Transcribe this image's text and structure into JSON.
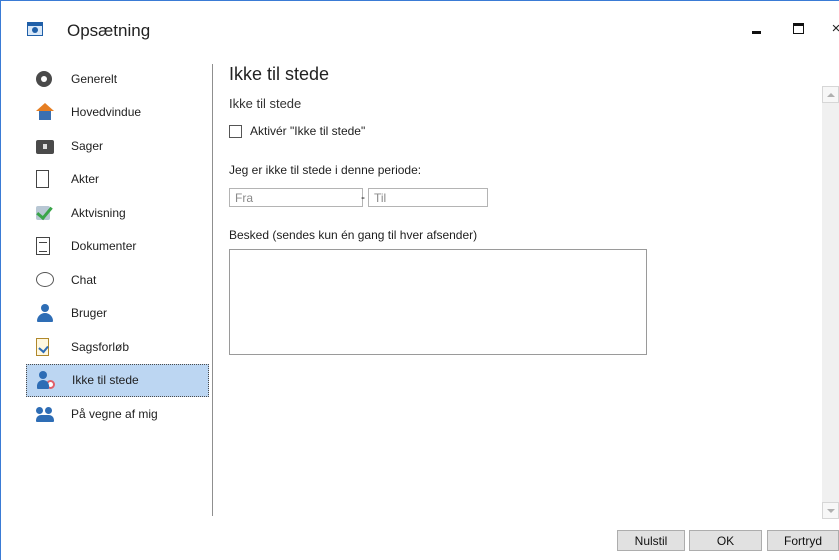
{
  "window": {
    "title": "Opsætning",
    "minimize_icon": "minimize-icon",
    "maximize_icon": "maximize-icon",
    "close_glyph": "×"
  },
  "sidebar": {
    "items": [
      {
        "label": "Generelt",
        "icon": "gear-icon"
      },
      {
        "label": "Hovedvindue",
        "icon": "house-icon"
      },
      {
        "label": "Sager",
        "icon": "briefcase-icon"
      },
      {
        "label": "Akter",
        "icon": "document-icon"
      },
      {
        "label": "Aktvisning",
        "icon": "checkmark-icon"
      },
      {
        "label": "Dokumenter",
        "icon": "documents-icon"
      },
      {
        "label": "Chat",
        "icon": "chat-bubble-icon"
      },
      {
        "label": "Bruger",
        "icon": "user-icon"
      },
      {
        "label": "Sagsforløb",
        "icon": "clipboard-check-icon"
      },
      {
        "label": "Ikke til stede",
        "icon": "user-away-icon",
        "selected": true
      },
      {
        "label": "På vegne af mig",
        "icon": "user-group-icon"
      }
    ]
  },
  "main": {
    "heading": "Ikke til stede",
    "subheading": "Ikke til stede",
    "activate_label": "Aktivér \"Ikke til stede\"",
    "activate_checked": false,
    "period_label": "Jeg er ikke til stede i denne periode:",
    "from_placeholder": "Fra",
    "to_placeholder": "Til",
    "range_separator": "-",
    "message_label": "Besked (sendes kun én gang til hver afsender)",
    "message_value": ""
  },
  "footer": {
    "reset_label": "Nulstil",
    "ok_label": "OK",
    "cancel_label": "Fortryd"
  },
  "colors": {
    "selection": "#bcd6f2",
    "accent": "#2e6db5"
  }
}
